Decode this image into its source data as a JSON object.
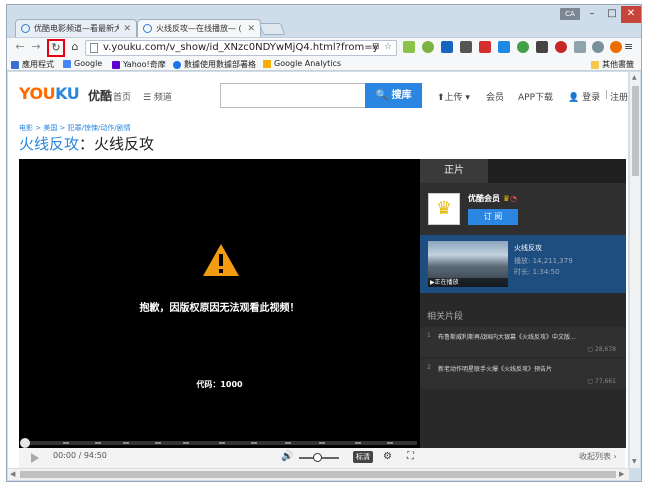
{
  "browser": {
    "tabs": [
      {
        "title": "优酷电影频道—看最新大",
        "active": false
      },
      {
        "title": "火线反攻—在线播放— (",
        "active": true
      }
    ],
    "user_badge": "CA",
    "window_buttons": {
      "min": "–",
      "max": "□",
      "close": "✕"
    },
    "url": "v.youku.com/v_show/id_XNzc0NDYwMjQ4.html?from=y",
    "bookmarks": [
      {
        "label": "應用程式",
        "icon_color": "#3b6fd4"
      },
      {
        "label": "Google",
        "icon_color": "#4285f4"
      },
      {
        "label": "Yahoo!奇摩",
        "icon_color": "#5f01d1"
      },
      {
        "label": "數據使用數據部署格",
        "icon_color": "#1a73e8"
      },
      {
        "label": "Google Analytics",
        "icon_color": "#f9ab00"
      }
    ],
    "bookmarks_other": "其他書籤",
    "highlight_color": "#e60012"
  },
  "site": {
    "logo_you": "YOU",
    "logo_ku": "KU",
    "logo_cn": "优酷",
    "nav_home": "首页",
    "nav_channel": "☰ 频道",
    "search_placeholder": "",
    "search_button": "🔍 搜库",
    "nav_upload": "⬆上传 ▾",
    "nav_member": "会员",
    "nav_app": "APP下载",
    "nav_login": "👤 登录",
    "nav_register": "注册"
  },
  "breadcrumb": "电影 > 美国 > 犯罪/惊悚/动作/剧情",
  "video_title_link": "火线反攻",
  "video_title_rest": "：火线反攻",
  "player": {
    "error_message": "抱歉，因版权原因无法观看此视频！",
    "error_code": "代码：1000",
    "time": "00:00 / 94:50",
    "hd_label": "标清",
    "collapse_label": "收起列表"
  },
  "sidebar": {
    "tab_label": "正片",
    "vip_name": "优酷会员",
    "vip_button": "订 阅",
    "now_title": "火线反攻",
    "now_plays": "播放: 14,211,379",
    "now_duration": "时长: 1:34:50",
    "now_tag": "▶正在播放",
    "related_heading": "相关片段",
    "related": [
      {
        "num": "1",
        "title": "布鲁斯威利斯再战国内大银幕《火线反攻》中文版...",
        "count": "▢ 28,678"
      },
      {
        "num": "2",
        "title": "新老动作明星联手火爆《火线反攻》预告片",
        "count": "▢ 77,661"
      }
    ]
  }
}
